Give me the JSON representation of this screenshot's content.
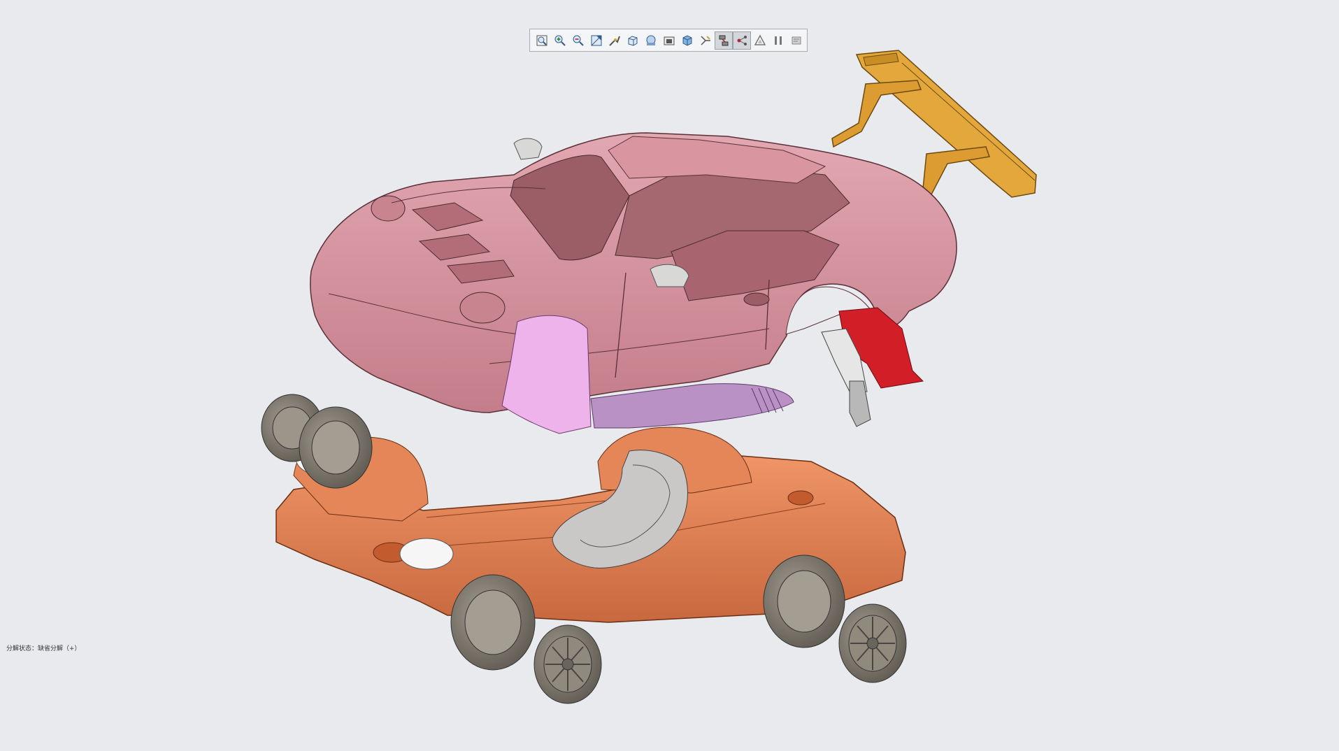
{
  "toolbar": {
    "buttons": [
      {
        "name": "refit-icon",
        "active": false
      },
      {
        "name": "zoom-in-icon",
        "active": false
      },
      {
        "name": "zoom-out-icon",
        "active": false
      },
      {
        "name": "zoom-area-icon",
        "active": false
      },
      {
        "name": "reorient-icon",
        "active": false
      },
      {
        "name": "saved-orientations-icon",
        "active": false
      },
      {
        "name": "display-style-icon",
        "active": false
      },
      {
        "name": "view-manager-icon",
        "active": false
      },
      {
        "name": "appearance-icon",
        "active": false
      },
      {
        "name": "datum-display-icon",
        "active": false
      },
      {
        "name": "explode-view-icon",
        "active": true
      },
      {
        "name": "edit-position-icon",
        "active": true
      },
      {
        "name": "annotation-display-icon",
        "active": false
      },
      {
        "name": "pause-icon",
        "active": false
      },
      {
        "name": "spin-center-icon",
        "active": false
      }
    ]
  },
  "status": {
    "text": "分解状态：缺省分解（+）"
  },
  "colors": {
    "background": "#e9eaed",
    "body": "#d7949f",
    "chassis": "#e07f55",
    "wing": "#e3a73c",
    "red_part": "#d21f27",
    "tire": "#7f786c",
    "lilac_panel": "#efb3ec",
    "seat": "#c9c8c6"
  }
}
